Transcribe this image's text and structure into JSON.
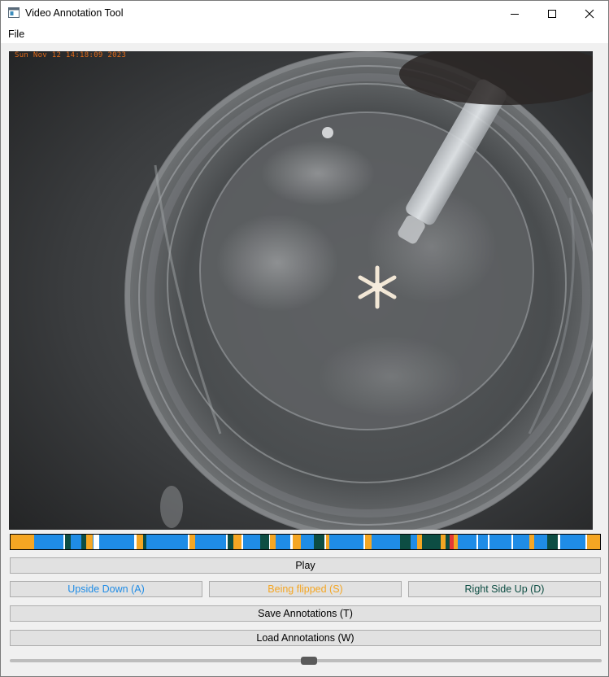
{
  "window": {
    "title": "Video Annotation Tool",
    "icon": "window-app-icon",
    "controls": [
      "minimize-icon",
      "maximize-icon",
      "close-icon"
    ]
  },
  "menu": {
    "file": "File"
  },
  "video": {
    "timestamp": "Sun Nov 12 14:18:09 2023",
    "timestamp_color": "#e06a1a"
  },
  "timeline": {
    "colors": {
      "upside_down": "#1f8ce6",
      "being_flipped": "#f5a623",
      "right_side_up": "#0d4d43",
      "unlabeled": "#ffffff",
      "current": "#e53935"
    },
    "segments": [
      {
        "start": 0.0,
        "end": 0.04,
        "label": "being_flipped"
      },
      {
        "start": 0.04,
        "end": 0.09,
        "label": "upside_down"
      },
      {
        "start": 0.09,
        "end": 0.093,
        "label": "unlabeled"
      },
      {
        "start": 0.093,
        "end": 0.102,
        "label": "right_side_up"
      },
      {
        "start": 0.102,
        "end": 0.12,
        "label": "upside_down"
      },
      {
        "start": 0.12,
        "end": 0.128,
        "label": "right_side_up"
      },
      {
        "start": 0.128,
        "end": 0.14,
        "label": "being_flipped"
      },
      {
        "start": 0.14,
        "end": 0.15,
        "label": "unlabeled"
      },
      {
        "start": 0.15,
        "end": 0.21,
        "label": "upside_down"
      },
      {
        "start": 0.21,
        "end": 0.214,
        "label": "unlabeled"
      },
      {
        "start": 0.214,
        "end": 0.225,
        "label": "being_flipped"
      },
      {
        "start": 0.225,
        "end": 0.23,
        "label": "right_side_up"
      },
      {
        "start": 0.23,
        "end": 0.3,
        "label": "upside_down"
      },
      {
        "start": 0.3,
        "end": 0.303,
        "label": "unlabeled"
      },
      {
        "start": 0.303,
        "end": 0.313,
        "label": "being_flipped"
      },
      {
        "start": 0.313,
        "end": 0.365,
        "label": "upside_down"
      },
      {
        "start": 0.365,
        "end": 0.368,
        "label": "unlabeled"
      },
      {
        "start": 0.368,
        "end": 0.378,
        "label": "right_side_up"
      },
      {
        "start": 0.378,
        "end": 0.392,
        "label": "being_flipped"
      },
      {
        "start": 0.392,
        "end": 0.395,
        "label": "unlabeled"
      },
      {
        "start": 0.395,
        "end": 0.423,
        "label": "upside_down"
      },
      {
        "start": 0.423,
        "end": 0.438,
        "label": "right_side_up"
      },
      {
        "start": 0.438,
        "end": 0.44,
        "label": "unlabeled"
      },
      {
        "start": 0.44,
        "end": 0.45,
        "label": "being_flipped"
      },
      {
        "start": 0.45,
        "end": 0.475,
        "label": "upside_down"
      },
      {
        "start": 0.475,
        "end": 0.478,
        "label": "unlabeled"
      },
      {
        "start": 0.478,
        "end": 0.492,
        "label": "being_flipped"
      },
      {
        "start": 0.492,
        "end": 0.514,
        "label": "upside_down"
      },
      {
        "start": 0.514,
        "end": 0.532,
        "label": "right_side_up"
      },
      {
        "start": 0.532,
        "end": 0.535,
        "label": "unlabeled"
      },
      {
        "start": 0.535,
        "end": 0.54,
        "label": "being_flipped"
      },
      {
        "start": 0.54,
        "end": 0.555,
        "label": "upside_down"
      },
      {
        "start": 0.555,
        "end": 0.598,
        "label": "upside_down"
      },
      {
        "start": 0.598,
        "end": 0.601,
        "label": "unlabeled"
      },
      {
        "start": 0.601,
        "end": 0.612,
        "label": "being_flipped"
      },
      {
        "start": 0.612,
        "end": 0.66,
        "label": "upside_down"
      },
      {
        "start": 0.66,
        "end": 0.678,
        "label": "right_side_up"
      },
      {
        "start": 0.678,
        "end": 0.69,
        "label": "upside_down"
      },
      {
        "start": 0.69,
        "end": 0.698,
        "label": "being_flipped"
      },
      {
        "start": 0.698,
        "end": 0.73,
        "label": "right_side_up"
      },
      {
        "start": 0.73,
        "end": 0.738,
        "label": "being_flipped"
      },
      {
        "start": 0.738,
        "end": 0.745,
        "label": "right_side_up"
      },
      {
        "start": 0.745,
        "end": 0.752,
        "label": "current"
      },
      {
        "start": 0.752,
        "end": 0.758,
        "label": "being_flipped"
      },
      {
        "start": 0.758,
        "end": 0.79,
        "label": "upside_down"
      },
      {
        "start": 0.79,
        "end": 0.793,
        "label": "unlabeled"
      },
      {
        "start": 0.793,
        "end": 0.81,
        "label": "upside_down"
      },
      {
        "start": 0.81,
        "end": 0.813,
        "label": "unlabeled"
      },
      {
        "start": 0.813,
        "end": 0.85,
        "label": "upside_down"
      },
      {
        "start": 0.85,
        "end": 0.853,
        "label": "unlabeled"
      },
      {
        "start": 0.853,
        "end": 0.88,
        "label": "upside_down"
      },
      {
        "start": 0.88,
        "end": 0.888,
        "label": "being_flipped"
      },
      {
        "start": 0.888,
        "end": 0.91,
        "label": "upside_down"
      },
      {
        "start": 0.91,
        "end": 0.928,
        "label": "right_side_up"
      },
      {
        "start": 0.928,
        "end": 0.932,
        "label": "unlabeled"
      },
      {
        "start": 0.932,
        "end": 0.975,
        "label": "upside_down"
      },
      {
        "start": 0.975,
        "end": 0.978,
        "label": "unlabeled"
      },
      {
        "start": 0.978,
        "end": 1.0,
        "label": "being_flipped"
      }
    ]
  },
  "buttons": {
    "play": "Play",
    "upside_down": "Upside Down (A)",
    "being_flipped": "Being flipped (S)",
    "right_side_up": "Right Side Up (D)",
    "save": "Save Annotations (T)",
    "load": "Load Annotations (W)"
  },
  "button_colors": {
    "upside_down": "#1f8ce6",
    "being_flipped": "#f5a623",
    "right_side_up": "#0d4d43"
  },
  "slider": {
    "position": 0.505
  }
}
